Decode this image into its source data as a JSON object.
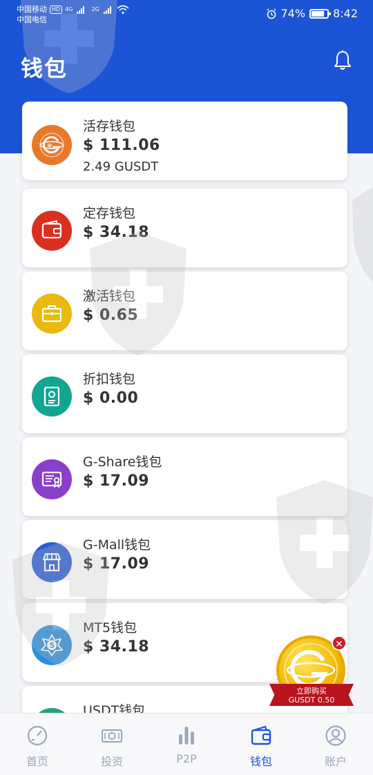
{
  "status_bar": {
    "carrier1": "中国移动",
    "carrier1_badge": "HD",
    "carrier1_net": "4G",
    "carrier2": "中国电信",
    "carrier2_net": "2G",
    "battery": "74%",
    "time": "8:42"
  },
  "header": {
    "title": "钱包"
  },
  "wallets": [
    {
      "name": "活存钱包",
      "amount": "$ 111.06",
      "sub": "2.49 GUSDT",
      "icon": "gusdt-coin-icon",
      "color": "#e8782a"
    },
    {
      "name": "定存钱包",
      "amount": "$ 34.18",
      "icon": "wallet-icon",
      "color": "#d9301f"
    },
    {
      "name": "激活钱包",
      "amount": "$ 0.65",
      "icon": "briefcase-icon",
      "color": "#e9b90d"
    },
    {
      "name": "折扣钱包",
      "amount": "$ 0.00",
      "icon": "certificate-icon",
      "color": "#14a592"
    },
    {
      "name": "G-Share钱包",
      "amount": "$ 17.09",
      "icon": "share-certificate-icon",
      "color": "#8a3fc9"
    },
    {
      "name": "G-Mall钱包",
      "amount": "$ 17.09",
      "icon": "store-icon",
      "color": "#2a5ed3"
    },
    {
      "name": "MT5钱包",
      "amount": "$ 34.18",
      "icon": "mt5-icon",
      "color": "#2b8fd9"
    },
    {
      "name": "USDT钱包",
      "amount": "",
      "icon": "usdt-icon",
      "color": "#26a17b"
    }
  ],
  "promo": {
    "line1": "立即购买",
    "line2": "GUSDT 0.50"
  },
  "tabs": [
    {
      "label": "首页",
      "icon": "dashboard-icon"
    },
    {
      "label": "投资",
      "icon": "money-icon"
    },
    {
      "label": "P2P",
      "icon": "bar-chart-icon"
    },
    {
      "label": "钱包",
      "icon": "wallet-icon",
      "active": true
    },
    {
      "label": "账户",
      "icon": "user-icon"
    }
  ],
  "colors": {
    "primary": "#1c54d6",
    "tab_inactive": "#9aa8bd"
  }
}
